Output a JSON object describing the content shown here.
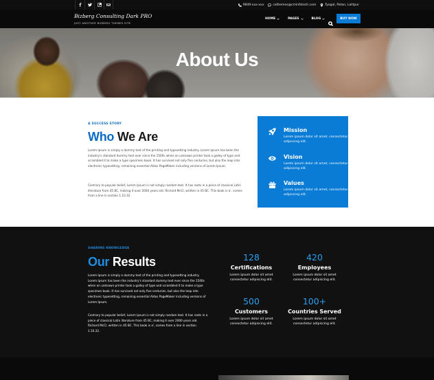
{
  "topbar": {
    "social_icons": [
      "facebook-icon",
      "twitter-icon",
      "instagram-icon",
      "email-icon"
    ],
    "phone": "9849-xxx-xxx",
    "email": "cathemes@cminfotech.com",
    "location": "Tyagal, Patan, Lalitpur"
  },
  "header": {
    "brand_title": "Bizberg Consulting Dark PRO",
    "brand_tagline": "JUST ANOTHER BIZBERG THEMES SITE",
    "nav": [
      {
        "label": "HOME"
      },
      {
        "label": "PAGES"
      },
      {
        "label": "BLOG"
      }
    ],
    "buy_now": "BUY NOW"
  },
  "hero": {
    "title": "About Us"
  },
  "about": {
    "eyebrow": "A SUCCESS STORY",
    "heading_blue": "Who",
    "heading_dark": "We Are",
    "p1": "Lorem Ipsum is simply a dummy text of the printing and typesetting industry. Lorem Ipsum has been the industry's standard dummy text ever since the 1500s when an unknown printer took a galley of type and scrambled it to make a type specimen book. It has survived not only five centuries, but also the leap into electronic typesetting, remaining essential Aldus PageMaker including versions of Lorem Ipsum.",
    "p2": "Contrary to popular belief, Lorem Ipsum is not simply random text. It has roots in a piece of classical Latin literature from 45 BC, making it over 2000 years old. Richard McCl, written in 45 BC. This book is a', comes from a line in section 1.10.32.",
    "card": [
      {
        "icon": "rocket-icon",
        "title": "Mission",
        "desc": "Lorem ipsum dolor sit amet, consectetur adipiscing elit."
      },
      {
        "icon": "eye-icon",
        "title": "Vision",
        "desc": "Lorem ipsum dolor sit amet, consectetur adipiscing elit."
      },
      {
        "icon": "gift-icon",
        "title": "Values",
        "desc": "Lorem ipsum dolor sit amet, consectetur adipiscing elit."
      }
    ]
  },
  "results": {
    "eyebrow": "SHARING KNOWLEDGE",
    "heading_blue": "Our",
    "heading_light": "Results",
    "p1": "Lorem Ipsum is simply a dummy text of the printing and typesetting industry. Lorem Ipsum has been the industry's standard dummy text ever since the 1500s when an unknown printer took a galley of type and scrambled it to make a type specimen book. It has survived not only five centuries, but also the leap into electronic typesetting, remaining essential Aldus PageMaker including versions of Lorem Ipsum.",
    "p2": "Contrary to popular belief, Lorem Ipsum is not simply random text. It has roots in a piece of classical Latin literature from 45 BC, making it over 2000 years old. Richard McCl, written in 45 BC. This book is a', comes from a line in section 1.10.32.",
    "stats": [
      {
        "num": "128",
        "label": "Certifications",
        "desc": "Lorem ipsum dolor sit amet consectetur adipiscing elit."
      },
      {
        "num": "420",
        "label": "Employees",
        "desc": "Lorem ipsum dolor sit amet consectetur adipiscing elit."
      },
      {
        "num": "500",
        "label": "Customers",
        "desc": "Lorem ipsum dolor sit amet consectetur adipiscing elit."
      },
      {
        "num": "100+",
        "label": "Countries Served",
        "desc": "Lorem ipsum dolor sit amet consectetur adipiscing elit."
      }
    ]
  },
  "colors": {
    "accent": "#0a7cd6",
    "stat_number": "#29a0f0",
    "dark_bg": "#111111"
  }
}
